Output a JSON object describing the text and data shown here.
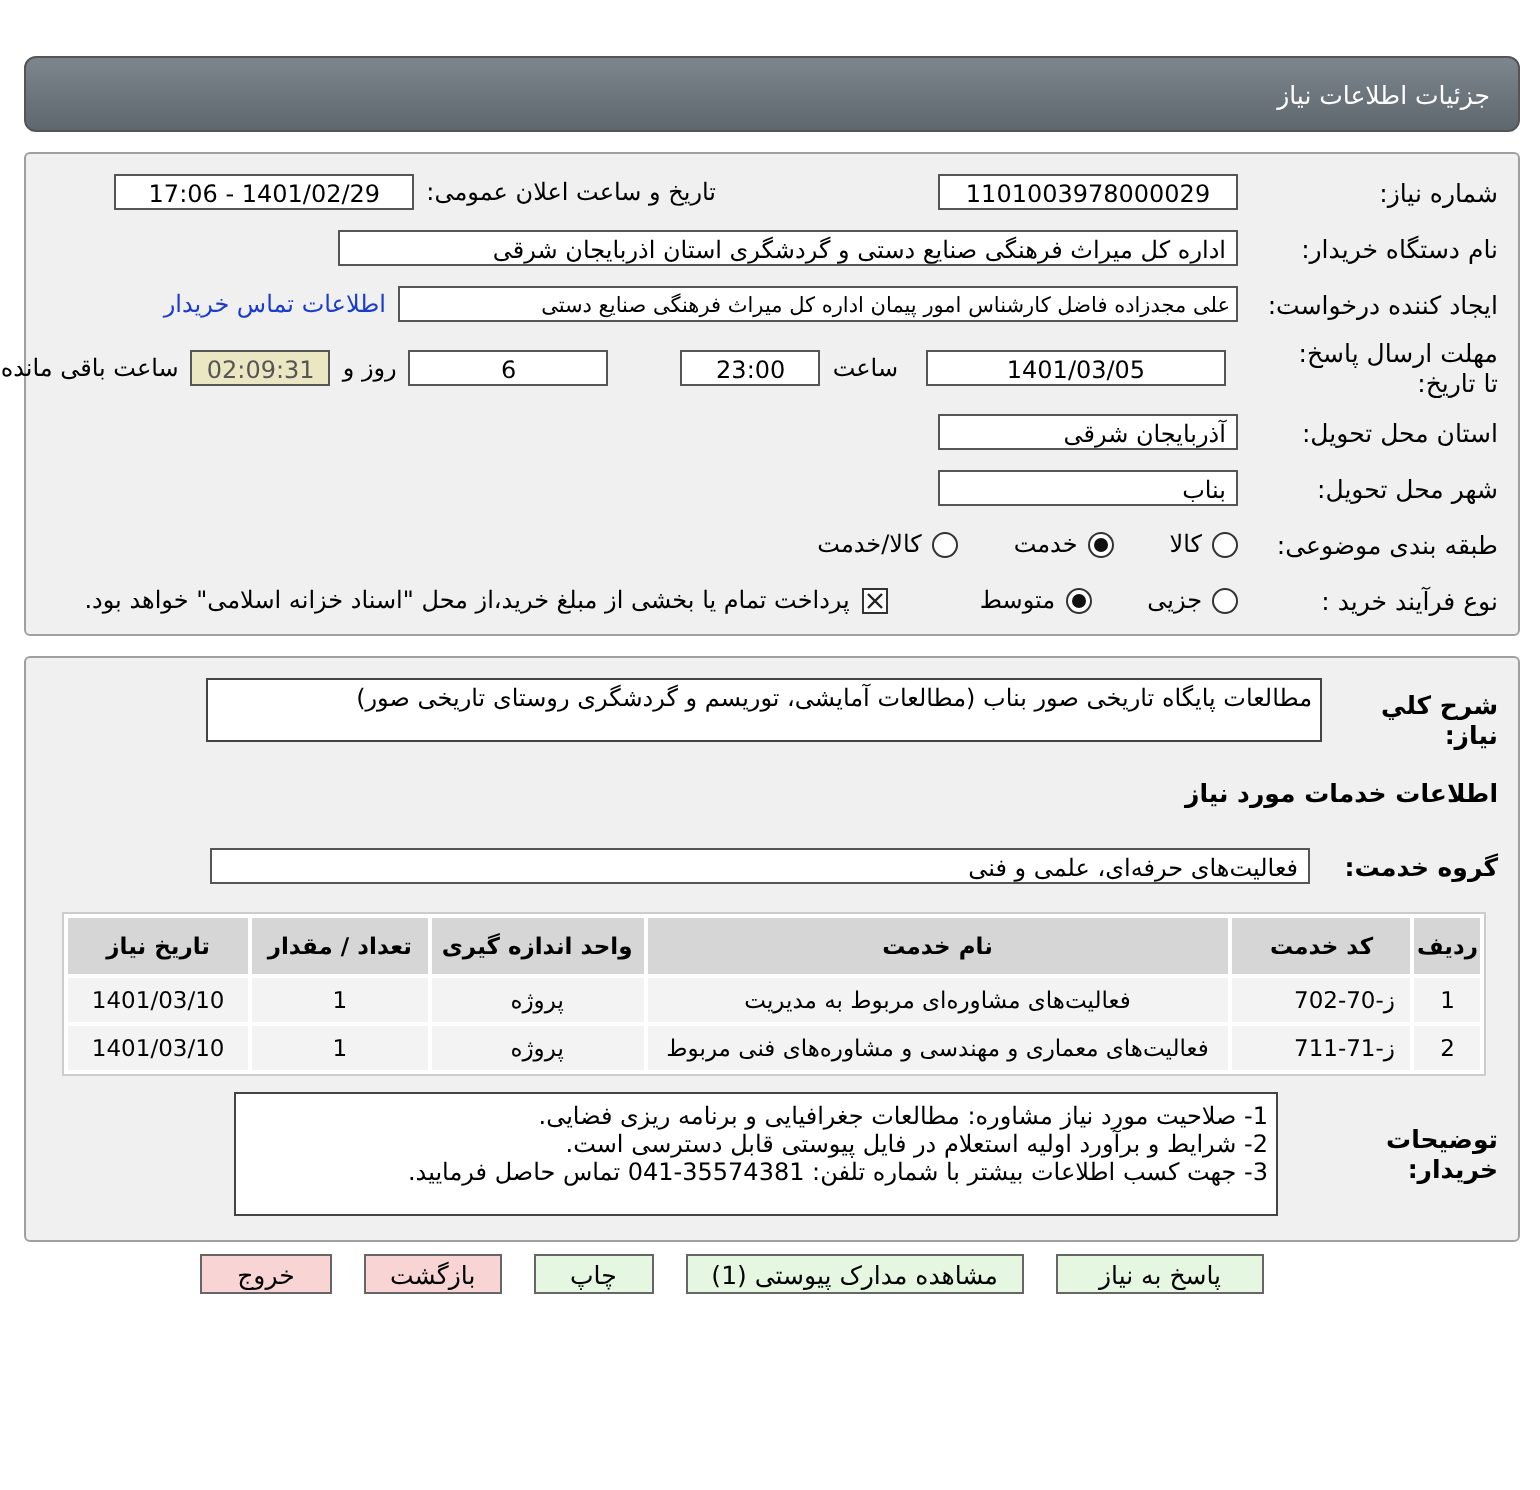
{
  "header": {
    "title": "جزئیات اطلاعات نیاز"
  },
  "need_number": {
    "label": "شماره نیاز:",
    "value": "1101003978000029"
  },
  "announce": {
    "label": "تاریخ و ساعت اعلان عمومی:",
    "value": "1401/02/29 - 17:06"
  },
  "buyer": {
    "label": "نام دستگاه خریدار:",
    "value": "اداره کل میراث فرهنگی  صنایع دستی و گردشگری استان اذربایجان شرقی"
  },
  "requester": {
    "label": "ایجاد کننده درخواست:",
    "value": "علی مجدزاده فاضل کارشناس امور پیمان اداره کل میراث فرهنگی  صنایع دستی",
    "link": "اطلاعات تماس خریدار"
  },
  "deadline": {
    "label": "مهلت ارسال پاسخ: تا تاریخ:",
    "date": "1401/03/05",
    "time_label": "ساعت",
    "time": "23:00",
    "days": "6",
    "days_label": "روز و",
    "remaining": "02:09:31",
    "remaining_label": "ساعت باقی مانده"
  },
  "province": {
    "label": "استان محل تحویل:",
    "value": "آذربایجان شرقی"
  },
  "city": {
    "label": "شهر محل تحویل:",
    "value": "بناب"
  },
  "category": {
    "label": "طبقه بندی موضوعی:",
    "options": [
      {
        "label": "کالا",
        "selected": false
      },
      {
        "label": "خدمت",
        "selected": true
      },
      {
        "label": "کالا/خدمت",
        "selected": false
      }
    ]
  },
  "process": {
    "label": "نوع فرآیند خرید :",
    "options": [
      {
        "label": "جزیی",
        "selected": false
      },
      {
        "label": "متوسط",
        "selected": true
      }
    ],
    "payment": {
      "checked": true,
      "text": "پرداخت تمام یا بخشی از مبلغ خرید،از محل \"اسناد خزانه اسلامی\" خواهد بود."
    }
  },
  "summary": {
    "label": "شرح کلي نياز:",
    "value": "مطالعات پایگاه تاریخی صور بناب (مطالعات آمایشی، توریسم و گردشگری روستای تاریخی صور)"
  },
  "services_title": "اطلاعات خدمات مورد نیاز",
  "service_group": {
    "label": "گروه خدمت:",
    "value": "فعالیت‌های حرفه‌ای، علمی و فنی"
  },
  "table": {
    "columns": [
      "ردیف",
      "کد خدمت",
      "نام خدمت",
      "واحد اندازه گیری",
      "تعداد / مقدار",
      "تاریخ نیاز"
    ],
    "rows": [
      [
        "1",
        "ز-70-702",
        "فعالیت‌های مشاوره‌ای مربوط به مدیریت",
        "پروژه",
        "1",
        "1401/03/10"
      ],
      [
        "2",
        "ز-71-711",
        "فعالیت‌های معماری و مهندسی و مشاوره‌های فنی مربوط",
        "پروژه",
        "1",
        "1401/03/10"
      ]
    ]
  },
  "buyer_notes": {
    "label": "توضیحات خریدار:",
    "lines": [
      "1- صلاحیت مورد نیاز مشاوره: مطالعات جغرافیایی و برنامه ریزی فضایی.",
      "2- شرایط و برآورد اولیه استعلام در فایل پیوستی قابل دسترسی است.",
      "3- جهت کسب اطلاعات بیشتر  با شماره تلفن: 35574381-041  تماس حاصل فرمایید."
    ]
  },
  "buttons": [
    {
      "label": "پاسخ به نیاز",
      "kind": "action"
    },
    {
      "label": "مشاهده مدارک پیوستی (1)",
      "kind": "action"
    },
    {
      "label": "چاپ",
      "kind": "action"
    },
    {
      "label": "بازگشت",
      "kind": "exit"
    },
    {
      "label": "خروج",
      "kind": "exit"
    }
  ]
}
